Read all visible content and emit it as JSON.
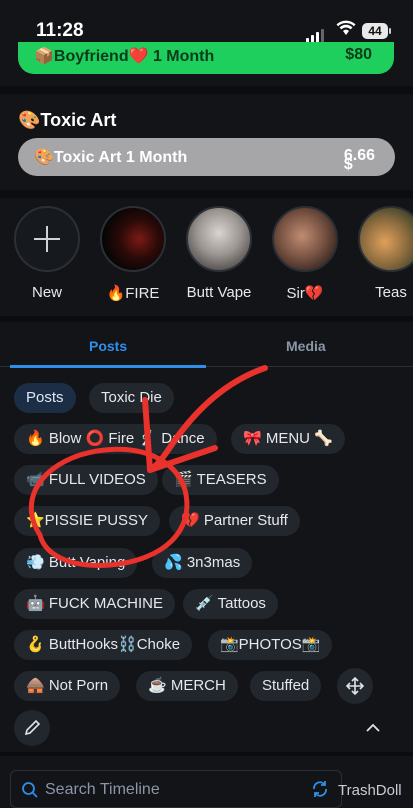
{
  "status_bar": {
    "time": "11:28",
    "battery": "44"
  },
  "top_banner": {
    "title": "📦Boyfriend❤️ 1 Month",
    "price": "$80"
  },
  "toxic_art": {
    "heading": "🎨Toxic Art",
    "button_label": "🎨Toxic Art 1 Month",
    "price_symbol": "$",
    "price": "6.66"
  },
  "stories": [
    {
      "label": "New"
    },
    {
      "label": "🔥FIRE"
    },
    {
      "label": "Butt Vape"
    },
    {
      "label": "Sir💔"
    },
    {
      "label": "Teas"
    }
  ],
  "tabs": [
    {
      "label": "Posts"
    },
    {
      "label": "Media"
    }
  ],
  "chips": [
    "Posts",
    "Toxic Die",
    "🔥 Blow ⭕ Fire 🕺 Dance",
    "🎀 MENU 🦴",
    "📹 FULL VIDEOS",
    "🎬 TEASERS",
    "⭐PISSIE PUSSY",
    "💔 Partner Stuff",
    "💨 Butt Vaping",
    "💦 3n3mas",
    "🤖 FUCK MACHINE",
    "💉 Tattoos",
    "🪝 ButtHooks⛓️Choke",
    "📸PHOTOS📸",
    "🛖 Not Porn",
    "☕ MERCH",
    "Stuffed"
  ],
  "search": {
    "placeholder": "Search Timeline"
  },
  "watermark": "TrashDoll",
  "colors": {
    "accent": "#2f8fe8",
    "green": "#1fcf5e",
    "annotation": "#e8322b"
  }
}
